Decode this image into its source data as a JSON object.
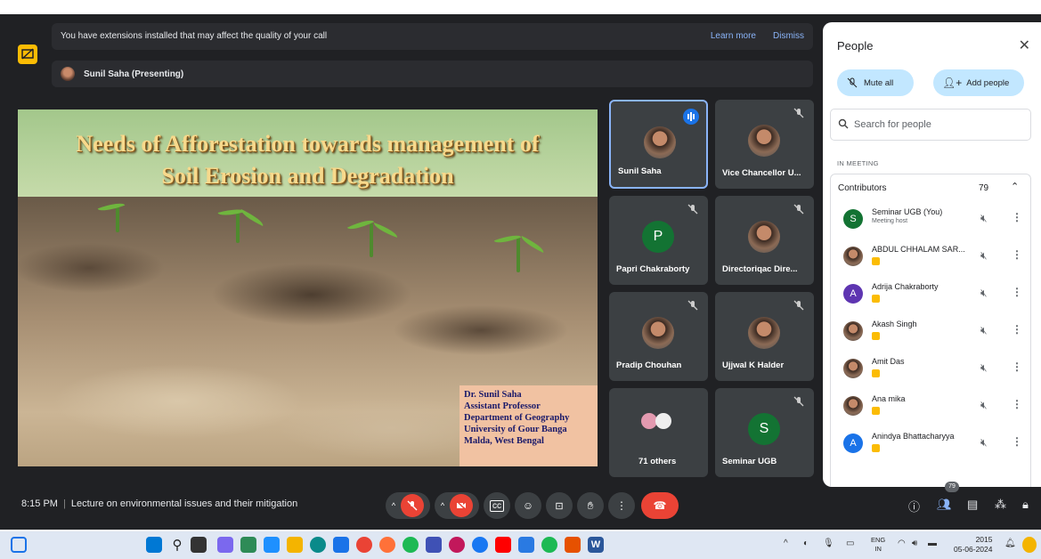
{
  "banner": {
    "message": "You have extensions installed that may affect the quality of your call",
    "learn_more": "Learn more",
    "dismiss": "Dismiss"
  },
  "presenting": {
    "label": "Sunil Saha (Presenting)"
  },
  "slide": {
    "title_line1": "Needs of Afforestation towards management of",
    "title_line2": "Soil Erosion and Degradation",
    "caption": [
      "Dr. Sunil Saha",
      "Assistant Professor",
      "Department of Geography",
      "University of Gour Banga",
      "Malda, West Bengal"
    ]
  },
  "tiles": [
    {
      "name": "Sunil Saha",
      "avatar": "photo"
    },
    {
      "name": "Vice Chancellor U...",
      "avatar": "photo"
    },
    {
      "name": "Papri Chakraborty",
      "avatar": "P",
      "color": "#137333"
    },
    {
      "name": "Directoriqac Dire...",
      "avatar": "photo"
    },
    {
      "name": "Pradip Chouhan",
      "avatar": "photo"
    },
    {
      "name": "Ujjwal K Halder",
      "avatar": "photo"
    },
    {
      "name": "71 others",
      "avatar": "group"
    },
    {
      "name": "Seminar UGB",
      "avatar": "S",
      "color": "#137333"
    }
  ],
  "people": {
    "title": "People",
    "mute_all": "Mute all",
    "add_people": "Add people",
    "search_placeholder": "Search for people",
    "in_meeting": "IN MEETING",
    "contributors": "Contributors",
    "count": "79",
    "list": [
      {
        "name": "Seminar UGB (You)",
        "sub": "Meeting host",
        "avatar": "S",
        "color": "#137333"
      },
      {
        "name": "ABDUL CHHALAM SAR...",
        "avatar": "photo"
      },
      {
        "name": "Adrija Chakraborty",
        "avatar": "A",
        "color": "#5e35b1"
      },
      {
        "name": "Akash Singh",
        "avatar": "photo"
      },
      {
        "name": "Amit Das",
        "avatar": "photo"
      },
      {
        "name": "Ana mika",
        "avatar": "photo"
      },
      {
        "name": "Anindya Bhattacharyya",
        "avatar": "A",
        "color": "#1a73e8"
      }
    ]
  },
  "footer": {
    "time": "8:15 PM",
    "meeting_title": "Lecture on environmental issues and their mitigation",
    "participant_badge": "79"
  },
  "taskbar": {
    "lang_top": "ENG",
    "lang_bottom": "IN",
    "clock_time": "2015",
    "clock_date": "05-06-2024"
  }
}
